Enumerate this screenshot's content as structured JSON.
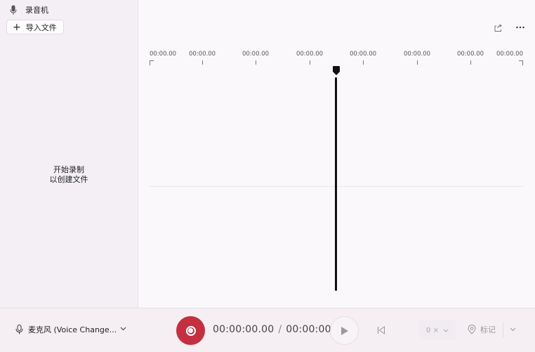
{
  "app": {
    "title": "录音机"
  },
  "sidebar": {
    "import_label": "导入文件",
    "empty_line1": "开始录制",
    "empty_line2": "以创建文件"
  },
  "timeline": {
    "ticks": [
      "00:00.00",
      "00:00.00",
      "00:00.00",
      "00:00.00",
      "00:00.00",
      "00:00.00",
      "00:00.00",
      "00:00.00"
    ]
  },
  "bottom": {
    "mic_label": "麦克风 (Voice Change...",
    "current_time": "00:00:00.00",
    "separator": "/",
    "total_time": "00:00:00",
    "speed": "0 ×",
    "marker_label": "标记"
  },
  "colors": {
    "record": "#c4303f"
  }
}
